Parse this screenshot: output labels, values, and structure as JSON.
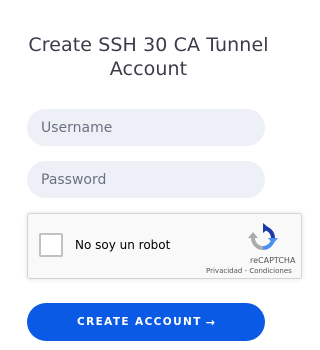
{
  "form": {
    "title_line1": "Create SSH 30 CA Tunnel",
    "title_line2": "Account",
    "username_placeholder": "Username",
    "password_placeholder": "Password",
    "submit_label": "CREATE ACCOUNT",
    "submit_icon": "arrow-right-icon",
    "accent_color": "#0a5ae6",
    "field_bg_color": "#eef0f8"
  },
  "recaptcha": {
    "label": "No soy un robot",
    "brand": "reCAPTCHA",
    "privacy": "Privacidad",
    "separator": " - ",
    "terms": "Condiciones",
    "checked": false,
    "logo_icon": "recaptcha-logo-icon"
  }
}
